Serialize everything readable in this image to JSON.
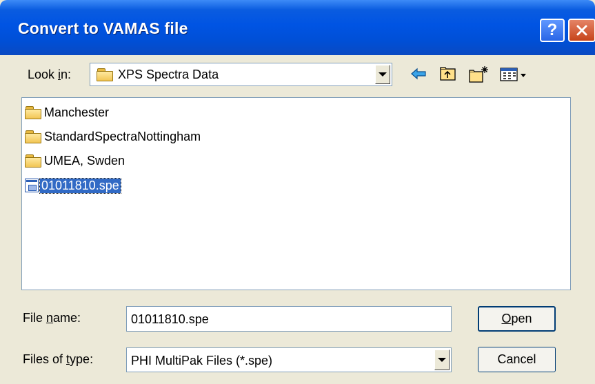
{
  "window": {
    "title": "Convert to VAMAS file"
  },
  "title_buttons": {
    "help": "?"
  },
  "look_in": {
    "label_pre": "Look ",
    "label_key": "i",
    "label_post": "n:",
    "value": "XPS Spectra Data"
  },
  "files": [
    {
      "name": "Manchester",
      "type": "folder"
    },
    {
      "name": "StandardSpectraNottingham",
      "type": "folder"
    },
    {
      "name": "UMEA, Swden",
      "type": "folder"
    },
    {
      "name": "01011810.spe",
      "type": "file",
      "selected": true
    }
  ],
  "file_name": {
    "label_pre": "File ",
    "label_key": "n",
    "label_post": "ame:",
    "value": "01011810.spe"
  },
  "file_type": {
    "label_pre": "Files of ",
    "label_key": "t",
    "label_post": "ype:",
    "value": "PHI MultiPak Files (*.spe)"
  },
  "buttons": {
    "open_key": "O",
    "open_rest": "pen",
    "cancel": "Cancel"
  },
  "colors": {
    "title_blue": "#0054e3",
    "selection": "#316ac5",
    "dialog_bg": "#ece9d8"
  }
}
